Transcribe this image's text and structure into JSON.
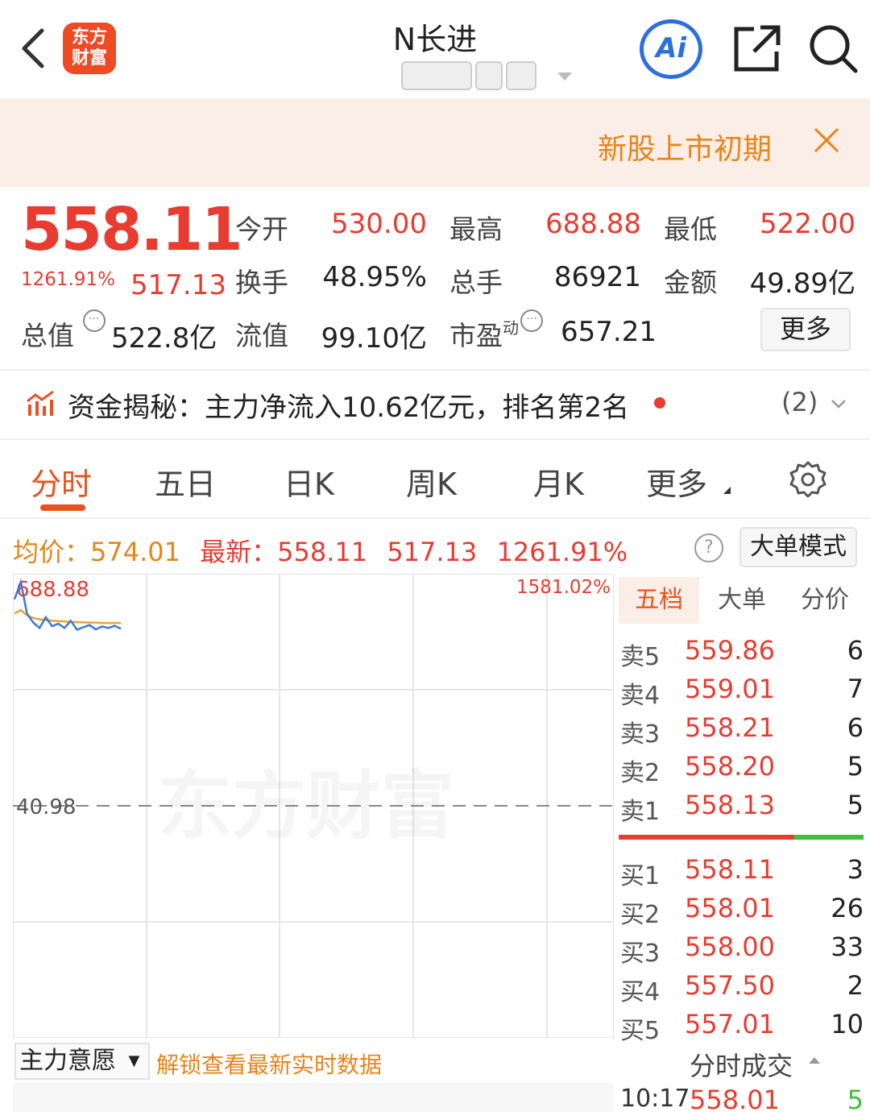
{
  "header": {
    "logo_line1": "东方",
    "logo_line2": "财富",
    "title": "N长进",
    "ai_label": "Ai",
    "icons": [
      "back-arrow-icon",
      "share-icon",
      "search-icon"
    ]
  },
  "banner": {
    "text": "新股上市初期"
  },
  "quote": {
    "price": "558.11",
    "change_pct": "1261.91%",
    "change": "517.13",
    "open_label": "今开",
    "open": "530.00",
    "high_label": "最高",
    "high": "688.88",
    "low_label": "最低",
    "low": "522.00",
    "turnover_label": "换手",
    "turnover": "48.95%",
    "volume_label": "总手",
    "volume": "86921",
    "amount_label": "金额",
    "amount": "49.89亿",
    "mktcap_label": "总值",
    "mktcap": "522.8亿",
    "float_label": "流值",
    "float": "99.10亿",
    "pe_label": "市盈",
    "pe_sup": "动",
    "pe": "657.21",
    "more": "更多"
  },
  "fund": {
    "text": "资金揭秘：主力净流入10.62亿元，排名第2名",
    "count": "(2)"
  },
  "tabs": [
    "分时",
    "五日",
    "日K",
    "周K",
    "月K",
    "更多"
  ],
  "info": {
    "avg_label": "均价：",
    "avg": "574.01",
    "last_label": "最新：",
    "last": "558.11",
    "chg": "517.13",
    "pct": "1261.91%",
    "mode_button": "大单模式"
  },
  "chart_data": {
    "type": "line",
    "y_top_label": "688.88",
    "y_top_pct": "1581.02%",
    "y_ref_label": "40.98",
    "watermark": "东方财富",
    "series": [
      {
        "values": [
          640,
          688,
          600,
          575,
          560,
          590,
          565,
          572,
          560,
          580,
          555,
          562,
          568,
          556,
          564,
          560,
          566,
          558
        ]
      },
      {
        "values": [
          600,
          610,
          595,
          588,
          584,
          582,
          580,
          579,
          578,
          577,
          576,
          576,
          575,
          575,
          574,
          574,
          574,
          574
        ]
      }
    ],
    "series_colors": [
      "#3a7bd5",
      "#e8a23a"
    ]
  },
  "orderbook": {
    "tabs": [
      "五档",
      "大单",
      "分价"
    ],
    "sell": [
      {
        "label": "卖5",
        "price": "559.86",
        "vol": "6"
      },
      {
        "label": "卖4",
        "price": "559.01",
        "vol": "7"
      },
      {
        "label": "卖3",
        "price": "558.21",
        "vol": "6"
      },
      {
        "label": "卖2",
        "price": "558.20",
        "vol": "5"
      },
      {
        "label": "卖1",
        "price": "558.13",
        "vol": "5"
      }
    ],
    "buy": [
      {
        "label": "买1",
        "price": "558.11",
        "vol": "3"
      },
      {
        "label": "买2",
        "price": "558.01",
        "vol": "26"
      },
      {
        "label": "买3",
        "price": "558.00",
        "vol": "33"
      },
      {
        "label": "买4",
        "price": "557.50",
        "vol": "2"
      },
      {
        "label": "买5",
        "price": "557.01",
        "vol": "10"
      }
    ]
  },
  "bottom": {
    "intent": "主力意愿",
    "unlock": "解锁查看最新实时数据",
    "ticks_title": "分时成交",
    "tick": {
      "time": "10:17",
      "price": "558.01",
      "vol": "5"
    }
  }
}
